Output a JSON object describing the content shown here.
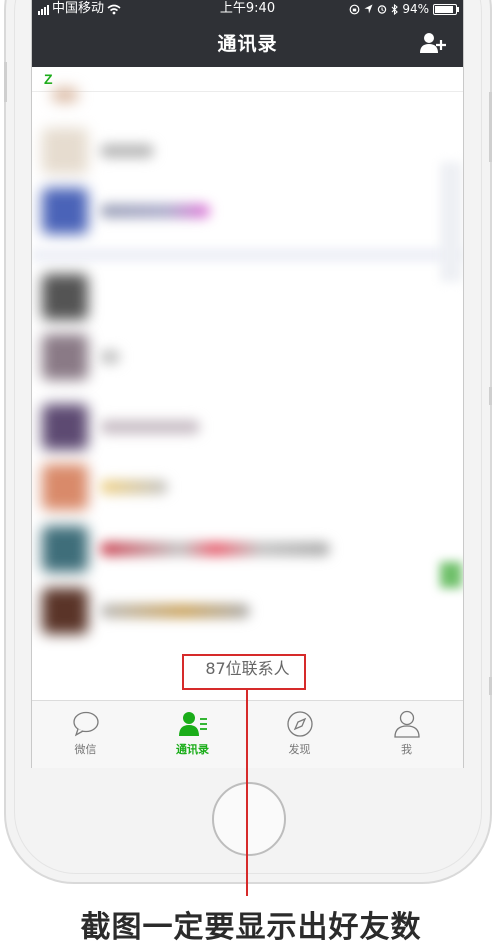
{
  "status_bar": {
    "carrier": "中国移动",
    "time": "上午9:40",
    "battery": "94%",
    "battery_level": 0.94
  },
  "nav": {
    "title": "通讯录",
    "add_icon": "add-contact-icon"
  },
  "section": {
    "letter": "Z"
  },
  "contacts_summary": {
    "count_text": "87位联系人"
  },
  "tabbar": {
    "items": [
      {
        "label": "微信",
        "icon": "chat-bubble-icon",
        "active": false
      },
      {
        "label": "通讯录",
        "icon": "contacts-icon",
        "active": true
      },
      {
        "label": "发现",
        "icon": "compass-icon",
        "active": false
      },
      {
        "label": "我",
        "icon": "person-icon",
        "active": false
      }
    ]
  },
  "annotation": {
    "caption": "截图一定要显示出好友数"
  },
  "colors": {
    "accent_green": "#1aad19",
    "nav_dark": "#2f3136",
    "annotation_red": "#d62a2a"
  }
}
